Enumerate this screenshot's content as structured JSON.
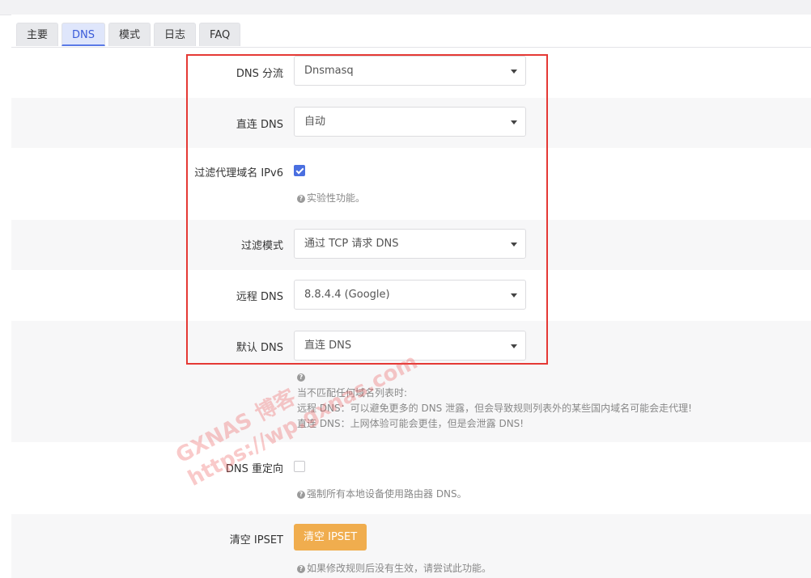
{
  "tabs": [
    {
      "label": "主要"
    },
    {
      "label": "DNS"
    },
    {
      "label": "模式"
    },
    {
      "label": "日志"
    },
    {
      "label": "FAQ"
    }
  ],
  "fields": {
    "dns_shunt": {
      "label": "DNS 分流",
      "value": "Dnsmasq"
    },
    "direct_dns": {
      "label": "直连 DNS",
      "value": "自动"
    },
    "filter_ipv6": {
      "label": "过滤代理域名 IPv6",
      "checked": true,
      "hint": "实验性功能。"
    },
    "filter_mode": {
      "label": "过滤模式",
      "value": "通过 TCP 请求 DNS"
    },
    "remote_dns": {
      "label": "远程 DNS",
      "value": "8.8.4.4 (Google)"
    },
    "default_dns": {
      "label": "默认 DNS",
      "value": "直连 DNS",
      "hint_lines": [
        "当不匹配任何域名列表时:",
        "远程 DNS：可以避免更多的 DNS 泄露，但会导致规则列表外的某些国内域名可能会走代理!",
        "直连 DNS：上网体验可能会更佳，但是会泄露 DNS!"
      ]
    },
    "dns_redirect": {
      "label": "DNS 重定向",
      "checked": false,
      "hint": "强制所有本地设备使用路由器 DNS。"
    },
    "clear_ipset": {
      "label": "清空 IPSET",
      "button": "清空 IPSET",
      "hint": "如果修改规则后没有生效，请尝试此功能。"
    }
  },
  "watermark": {
    "line1": "GXNAS 博客",
    "line2": "https://wp.gxnas.com"
  },
  "colors": {
    "accent": "#4a6fe0",
    "warning_button": "#f0ad4e",
    "highlight_box": "#e53935"
  }
}
